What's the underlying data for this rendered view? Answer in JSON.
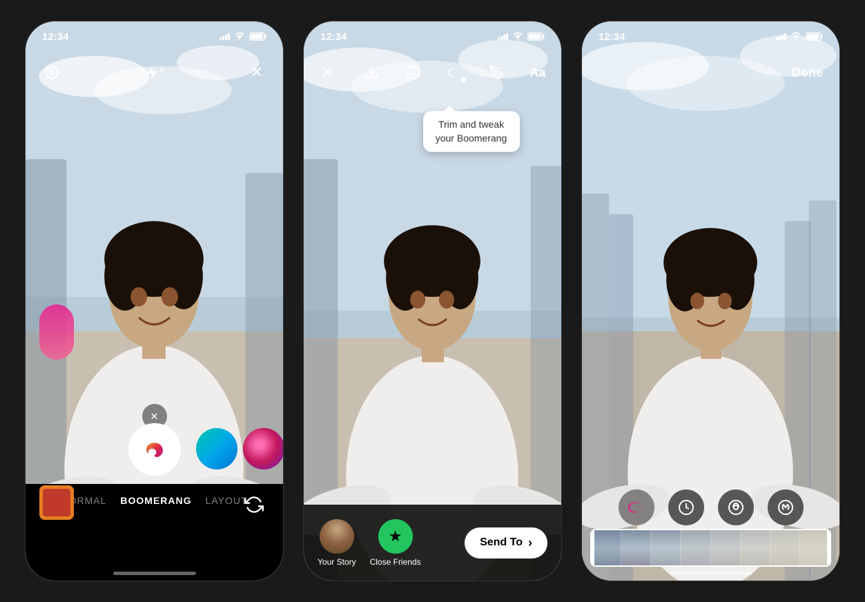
{
  "phone1": {
    "time": "12:34",
    "modes": {
      "normal": "NORMAL",
      "boomerang": "BOOMERANG",
      "layout": "LAYOUT"
    },
    "active_mode": "BOOMERANG"
  },
  "phone2": {
    "time": "12:34",
    "tooltip": "Trim and tweak your Boomerang",
    "story_options": [
      {
        "label": "Your Story",
        "type": "avatar"
      },
      {
        "label": "Close Friends",
        "type": "green"
      }
    ],
    "send_button": "Send To"
  },
  "phone3": {
    "time": "12:34",
    "done_button": "Done"
  },
  "icons": {
    "settings": "⚙",
    "flash_off": "⚡",
    "close": "✕",
    "download": "↓",
    "face": "☺",
    "boomerang": "∞",
    "text": "Aa",
    "flip": "↻",
    "draw": "✏",
    "arrow_right": "›"
  }
}
